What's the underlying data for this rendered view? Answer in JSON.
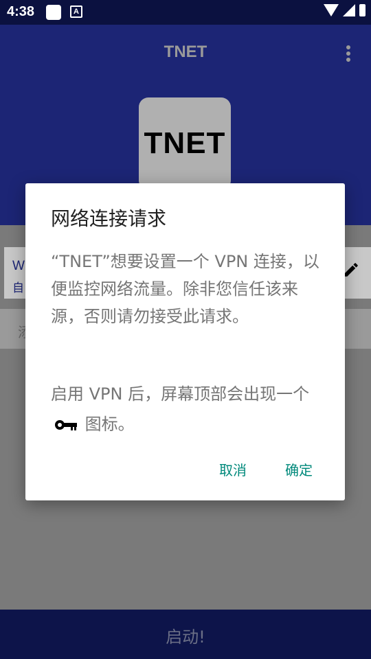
{
  "status_bar": {
    "time": "4:38"
  },
  "app_bar": {
    "title": "TNET",
    "logo_text": "TNET"
  },
  "card": {
    "line1": "W",
    "line2": "自"
  },
  "tab": {
    "label": "添"
  },
  "bottom": {
    "start_label": "启动!"
  },
  "dialog": {
    "title": "网络连接请求",
    "paragraph1": "“TNET”想要设置一个 VPN 连接，以便监控网络流量。除非您信任该来源，否则请勿接受此请求。",
    "paragraph2_before_icon": "启用 VPN 后，屏幕顶部会出现一个",
    "paragraph2_after_icon": "图标。",
    "cancel_label": "取消",
    "ok_label": "确定"
  },
  "colors": {
    "app_bar": "#1c2575",
    "status_bar": "#0b1140",
    "accent_button_text": "#00897b"
  }
}
